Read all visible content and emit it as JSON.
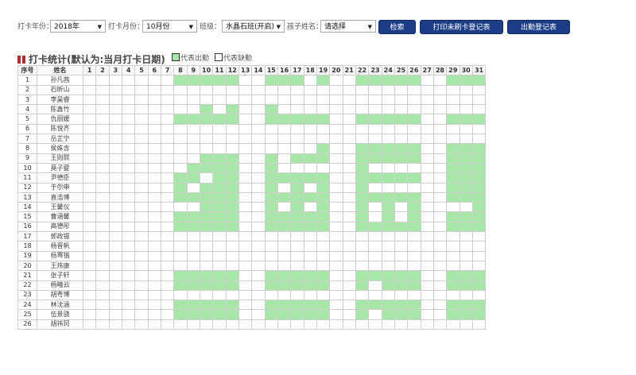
{
  "filters": {
    "year_label": "打卡年份：",
    "year_value": "2018年",
    "month_label": "打卡月份：",
    "month_value": "10月份",
    "class_label": "班级：",
    "class_value": "水晶石班(开启)",
    "child_label": "孩子姓名：",
    "child_value": "请选择"
  },
  "buttons": {
    "search": "检索",
    "print_unswiped": "打印未刷卡登记表",
    "attendance": "出勤登记表"
  },
  "section": {
    "title": "打卡统计(默认为:当月打卡日期)",
    "legend_present": "代表出勤",
    "legend_absent": "代表缺勤"
  },
  "colors": {
    "present": "#a8e5a8",
    "button": "#1c3d86"
  },
  "table": {
    "headers": {
      "index": "序号",
      "name": "姓名"
    },
    "days": [
      1,
      2,
      3,
      4,
      5,
      6,
      7,
      8,
      9,
      10,
      11,
      12,
      13,
      14,
      15,
      16,
      17,
      18,
      19,
      20,
      21,
      22,
      23,
      24,
      25,
      26,
      27,
      28,
      29,
      30,
      31
    ],
    "rows": [
      {
        "no": "1",
        "name": "孙凡茜",
        "present": [
          8,
          9,
          10,
          11,
          12,
          15,
          16,
          17,
          19,
          22,
          23,
          24,
          25,
          26,
          29,
          30,
          31
        ]
      },
      {
        "no": "2",
        "name": "石昕山",
        "present": []
      },
      {
        "no": "3",
        "name": "李昊睿",
        "present": []
      },
      {
        "no": "4",
        "name": "陈鑫竹",
        "present": [
          10,
          12,
          15
        ]
      },
      {
        "no": "5",
        "name": "仇丽媛",
        "present": [
          8,
          9,
          10,
          11,
          12,
          15,
          16,
          17,
          18,
          19,
          22,
          23,
          24,
          25,
          26,
          29,
          30,
          31
        ]
      },
      {
        "no": "6",
        "name": "陈悦齐",
        "present": []
      },
      {
        "no": "7",
        "name": "岳芷宁",
        "present": []
      },
      {
        "no": "8",
        "name": "侯姝含",
        "present": [
          19,
          22,
          23,
          24,
          25,
          26,
          29,
          30,
          31
        ]
      },
      {
        "no": "9",
        "name": "王则熙",
        "present": [
          10,
          11,
          12,
          15,
          17,
          18,
          19,
          22,
          23,
          24,
          25,
          26,
          29,
          30,
          31
        ]
      },
      {
        "no": "10",
        "name": "莫子夔",
        "present": [
          9,
          10,
          11,
          12,
          15,
          22,
          29,
          30,
          31
        ]
      },
      {
        "no": "11",
        "name": "尹德臣",
        "present": [
          8,
          9,
          11,
          12,
          15,
          16,
          17,
          18,
          19,
          22,
          23,
          24,
          25,
          26,
          29,
          30,
          31
        ]
      },
      {
        "no": "12",
        "name": "于尔申",
        "present": [
          8,
          10,
          11,
          12,
          15,
          17,
          19,
          22,
          29,
          30,
          31
        ]
      },
      {
        "no": "13",
        "name": "袁浩博",
        "present": [
          8,
          9,
          10,
          11,
          12,
          15,
          16,
          17,
          18,
          19,
          22,
          23,
          24,
          25,
          26,
          29,
          30,
          31
        ]
      },
      {
        "no": "14",
        "name": "王馨仪",
        "present": [
          10,
          11,
          12,
          15,
          17,
          19,
          22,
          24,
          26,
          31
        ]
      },
      {
        "no": "15",
        "name": "曹涵馨",
        "present": [
          8,
          9,
          10,
          11,
          12,
          15,
          16,
          17,
          18,
          19,
          22,
          24,
          26,
          29,
          30,
          31
        ]
      },
      {
        "no": "16",
        "name": "高德彤",
        "present": [
          8,
          9,
          10,
          11,
          12,
          15,
          16,
          17,
          18,
          19,
          22,
          23,
          24,
          25,
          26,
          29,
          30,
          31
        ]
      },
      {
        "no": "17",
        "name": "郭政锡",
        "present": []
      },
      {
        "no": "18",
        "name": "杨晋帆",
        "present": []
      },
      {
        "no": "19",
        "name": "杨骞锴",
        "present": []
      },
      {
        "no": "20",
        "name": "王炜康",
        "present": []
      },
      {
        "no": "21",
        "name": "张子轩",
        "present": [
          8,
          9,
          10,
          11,
          12,
          15,
          16,
          17,
          18,
          19,
          22,
          23,
          24,
          25,
          26,
          29,
          30,
          31
        ]
      },
      {
        "no": "22",
        "name": "杨曦云",
        "present": [
          8,
          9,
          10,
          11,
          12,
          15,
          16,
          17,
          18,
          19,
          22,
          24,
          25,
          26,
          29,
          30,
          31
        ]
      },
      {
        "no": "23",
        "name": "胡粤博",
        "present": []
      },
      {
        "no": "24",
        "name": "林沈涵",
        "present": [
          8,
          9,
          10,
          11,
          12,
          15,
          16,
          17,
          18,
          19,
          22,
          23,
          24,
          25,
          26,
          29,
          30,
          31
        ]
      },
      {
        "no": "25",
        "name": "伍景骁",
        "present": [
          8,
          9,
          10,
          11,
          12,
          15,
          16,
          17,
          18,
          19,
          22,
          24,
          25,
          26,
          29,
          30,
          31
        ]
      },
      {
        "no": "26",
        "name": "胡祎珂",
        "present": []
      }
    ]
  }
}
